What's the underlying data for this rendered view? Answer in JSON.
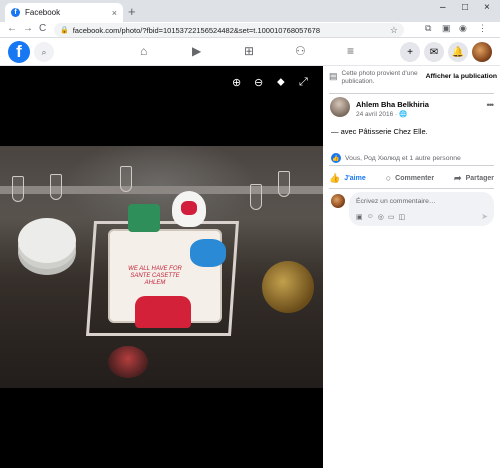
{
  "browser": {
    "tab_title": "Facebook",
    "tab_close": "×",
    "new_tab": "+",
    "url": "facebook.com/photo/?fbid=10153722156524482&set=t.100010768057678",
    "window_controls": [
      "–",
      "□",
      "×"
    ],
    "nav": [
      "←",
      "→",
      "C"
    ]
  },
  "facebook_header": {
    "logo": "f",
    "nav_icons": [
      "home-icon",
      "watch-icon",
      "marketplace-icon",
      "groups-icon",
      "menu-icon"
    ]
  },
  "viewer": {
    "cake_text": "WE ALL HAVE FOR SANTE CASETTE AHLEM",
    "tools": [
      "zoom-in-icon",
      "zoom-out-icon",
      "tag-icon",
      "fullscreen-icon"
    ]
  },
  "panel": {
    "notice_text": "Cette photo provient d'une publication.",
    "notice_link": "Afficher la publication",
    "author_name": "Ahlem Bha Belkhiria",
    "author_date": "24 avril 2016 · ",
    "more": "•••",
    "caption_prefix": "— avec ",
    "caption_page": "Pâtisserie Chez Elle",
    "caption_suffix": ".",
    "reactions_text": "Vous, Род Хюлюд et 1 autre personne",
    "actions": {
      "like": "J'aime",
      "comment": "Commenter",
      "share": "Partager"
    },
    "comment_placeholder": "Écrivez un commentaire…"
  }
}
